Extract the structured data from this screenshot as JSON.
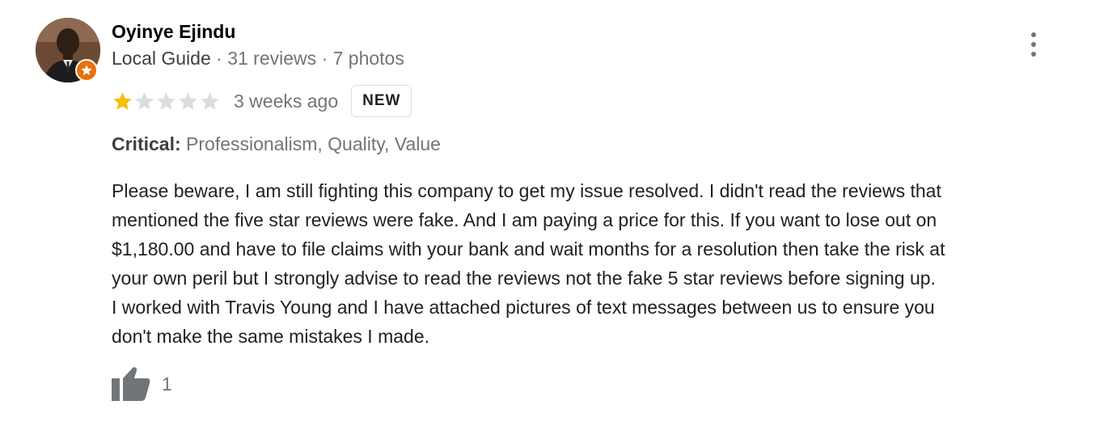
{
  "review": {
    "author_name": "Oyinye Ejindu",
    "author_badge": "Local Guide",
    "separator": " · ",
    "reviews_count": "31 reviews",
    "photos_count": "7 photos",
    "rating": 1,
    "rating_max": 5,
    "time_ago": "3 weeks ago",
    "new_label": "NEW",
    "critical_label": "Critical:",
    "critical_values": "Professionalism, Quality, Value",
    "text": "Please beware, I am still fighting this company to get my issue resolved. I didn't read the reviews that\nmentioned the five star reviews were fake. And I am paying a price for this. If you want to lose out on\n$1,180.00 and have to file claims with your bank and wait months for a resolution then take the risk at\nyour own peril but I strongly advise to read the reviews not the fake 5 star reviews before signing up.\nI worked with Travis Young and I have attached pictures of text messages between us to ensure you\ndon't make the same mistakes I made.",
    "like_count": "1"
  },
  "icons": {
    "more": "more-vert-icon",
    "like": "thumb-up-icon",
    "guide_badge": "local-guide-star-icon",
    "star": "star-icon"
  },
  "colors": {
    "star_filled": "#fbbc04",
    "star_empty": "#dadce0",
    "guide_badge": "#e8710a",
    "secondary_text": "#70757a",
    "icon_gray": "#70757a"
  }
}
